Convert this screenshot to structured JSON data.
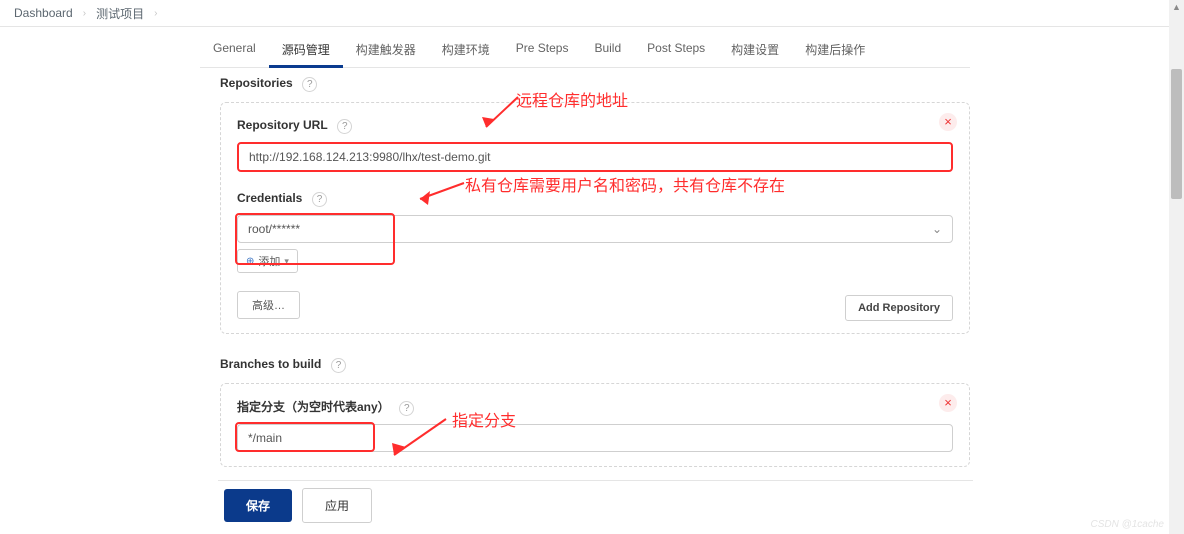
{
  "breadcrumb": {
    "item1": "Dashboard",
    "item2": "测试项目"
  },
  "tabs": {
    "general": "General",
    "scm": "源码管理",
    "triggers": "构建触发器",
    "env": "构建环境",
    "presteps": "Pre Steps",
    "build": "Build",
    "poststeps": "Post Steps",
    "settings": "构建设置",
    "postactions": "构建后操作"
  },
  "sections": {
    "repositories": "Repositories",
    "repo_url_label": "Repository URL",
    "credentials_label": "Credentials",
    "branches_label": "Branches to build",
    "branch_spec_label": "指定分支（为空时代表any）"
  },
  "fields": {
    "repo_url": "http://192.168.124.213:9980/lhx/test-demo.git",
    "credential_selected": "root/******",
    "branch_spec": "*/main"
  },
  "buttons": {
    "add_cred": "添加",
    "advanced": "高级…",
    "add_repo": "Add Repository",
    "save": "保存",
    "apply": "应用"
  },
  "annotations": {
    "a1": "远程仓库的地址",
    "a2": "私有仓库需要用户名和密码，共有仓库不存在",
    "a3": "指定分支"
  },
  "watermark": "CSDN @1cache"
}
